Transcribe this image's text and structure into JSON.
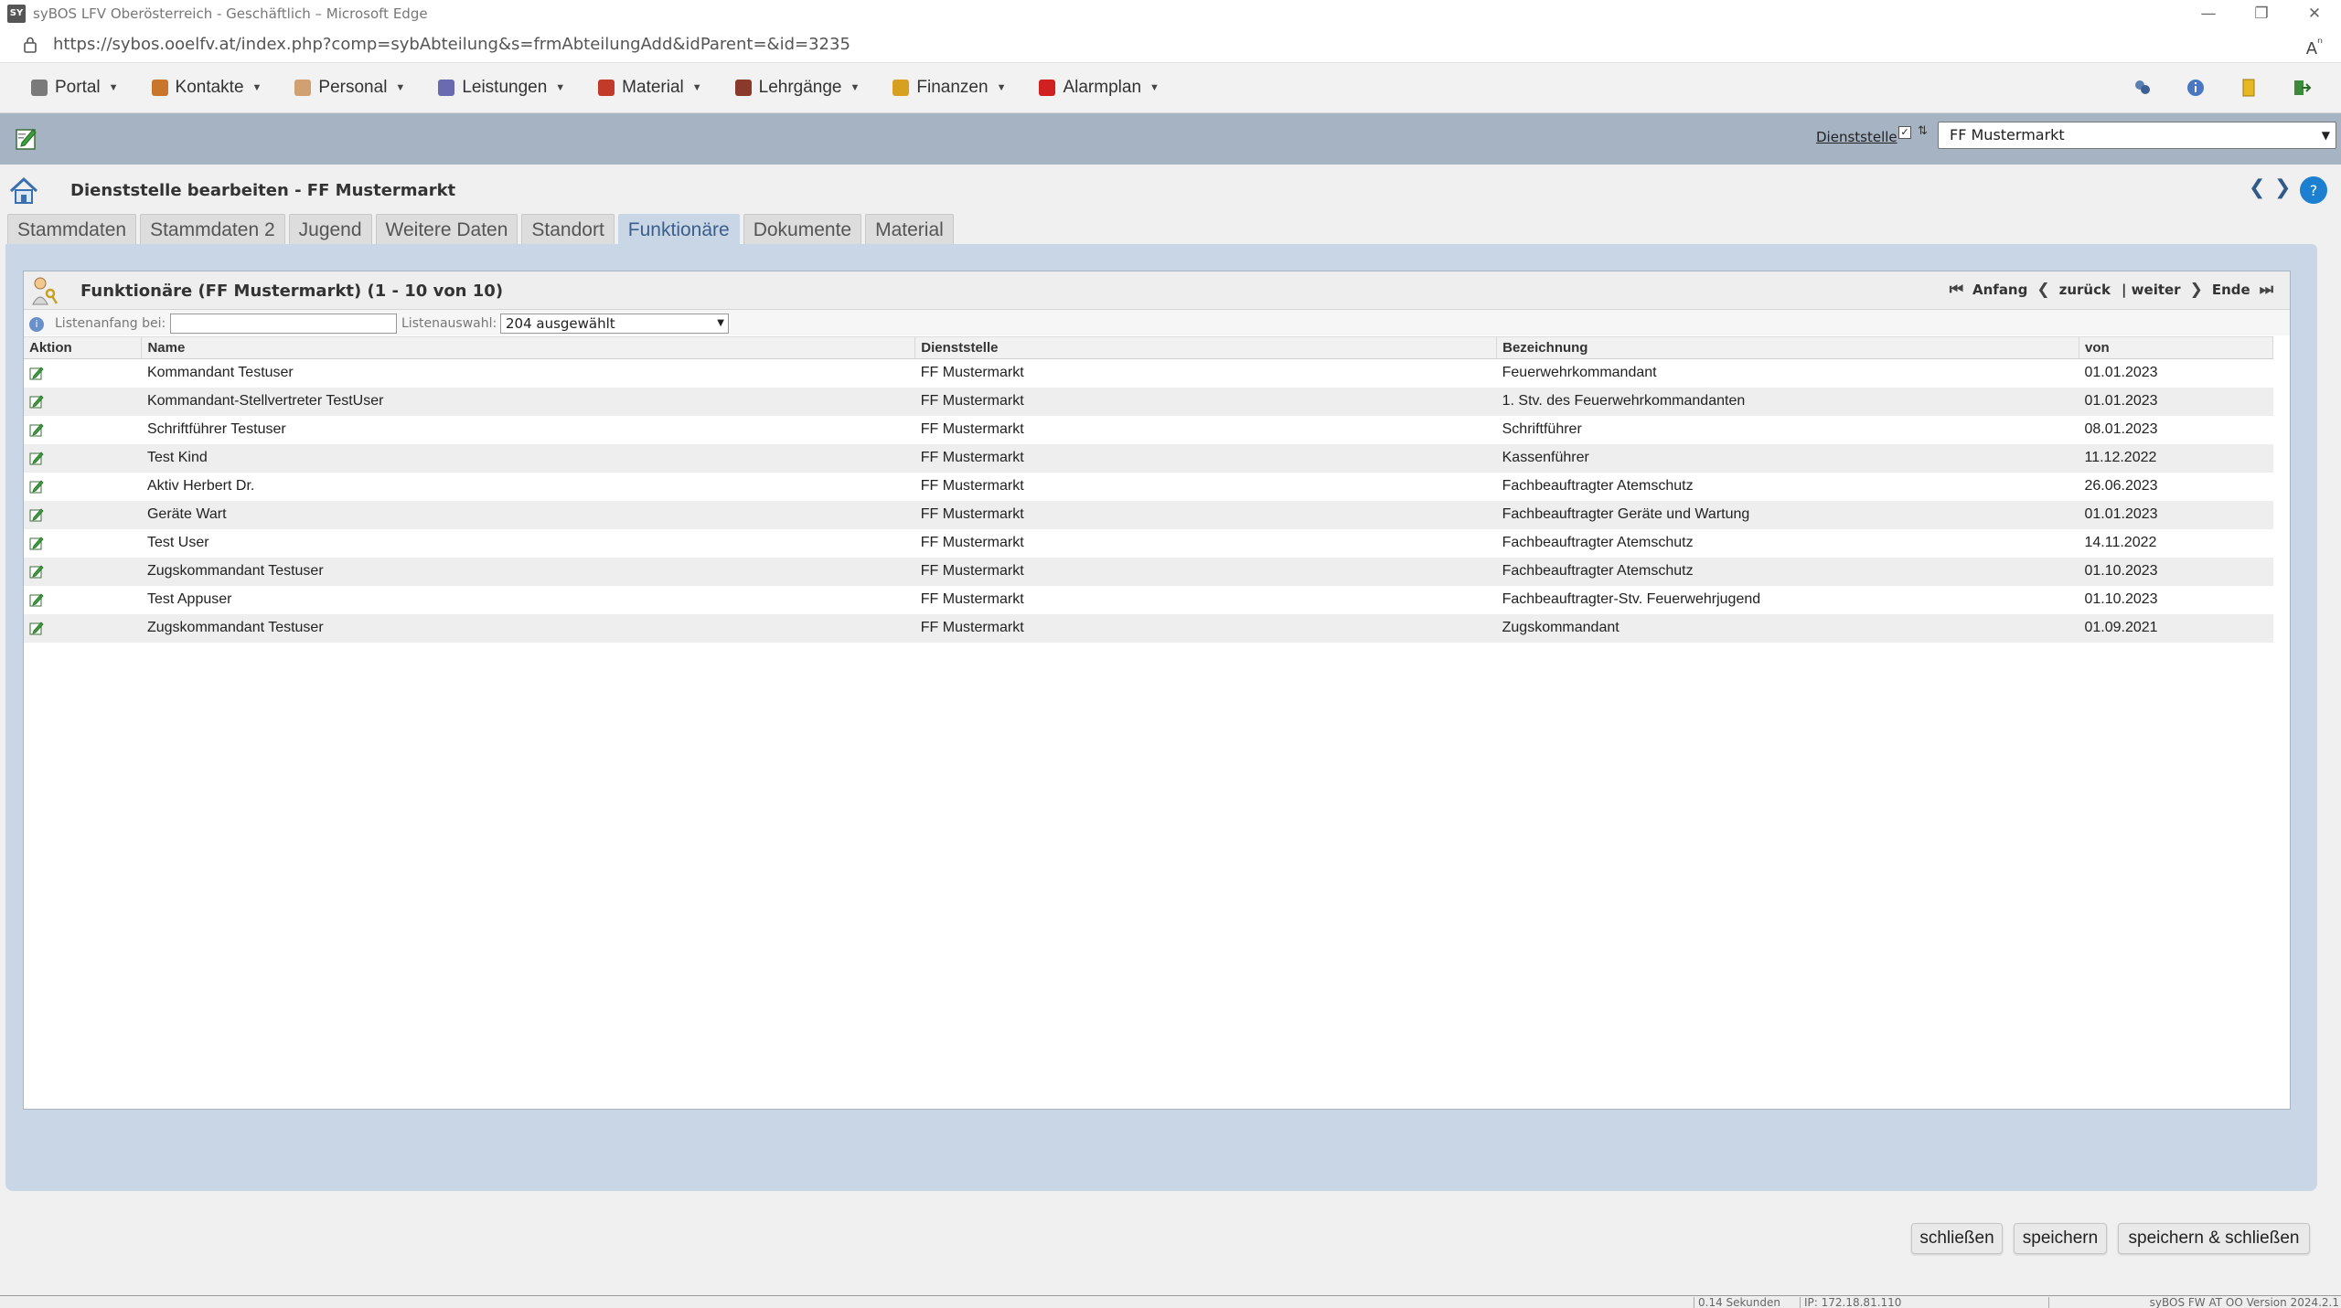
{
  "browser": {
    "window_title": "syBOS LFV Oberösterreich - Geschäftlich – Microsoft Edge",
    "url": "https://sybos.ooelfv.at/index.php?comp=sybAbteilung&s=frmAbteilungAdd&idParent=&id=3235",
    "favicon_text": "SY"
  },
  "menu": {
    "items": [
      {
        "label": "Portal",
        "icon": "portal-icon",
        "color": "#7a7a7a"
      },
      {
        "label": "Kontakte",
        "icon": "contacts-icon",
        "color": "#c8762b"
      },
      {
        "label": "Personal",
        "icon": "person-icon",
        "color": "#d0a070"
      },
      {
        "label": "Leistungen",
        "icon": "services-icon",
        "color": "#6a6ab0"
      },
      {
        "label": "Material",
        "icon": "truck-icon",
        "color": "#c23a2a"
      },
      {
        "label": "Lehrgänge",
        "icon": "course-icon",
        "color": "#8a3a2a"
      },
      {
        "label": "Finanzen",
        "icon": "money-icon",
        "color": "#d8a020"
      },
      {
        "label": "Alarmplan",
        "icon": "alarm-icon",
        "color": "#d02020"
      }
    ]
  },
  "toolbar": {
    "dienststelle_label": "Dienststelle",
    "dienststelle_check": "✓",
    "dienststelle_sort": "⇅",
    "dienststelle_value": "FF Mustermarkt"
  },
  "header": {
    "title": "Dienststelle bearbeiten - FF Mustermarkt",
    "prev": "❮",
    "next": "❯",
    "help": "?"
  },
  "tabs": [
    "Stammdaten",
    "Stammdaten 2",
    "Jugend",
    "Weitere Daten",
    "Standort",
    "Funktionäre",
    "Dokumente",
    "Material"
  ],
  "active_tab": "Funktionäre",
  "list": {
    "title": "Funktionäre (FF Mustermarkt) (1 - 10 von 10)",
    "pager": {
      "first_icon": "⏮",
      "first": "Anfang",
      "prev_icon": "❮",
      "prev": "zurück",
      "next": "| weiter",
      "next_icon": "❯",
      "last": "Ende",
      "last_icon": "⏭"
    },
    "filter": {
      "start_label": "Listenanfang bei:",
      "start_value": "",
      "select_label": "Listenauswahl:",
      "select_value": "204 ausgewählt"
    },
    "columns": [
      "Aktion",
      "Name",
      "Dienststelle",
      "Bezeichnung",
      "von"
    ],
    "rows": [
      {
        "name": "Kommandant Testuser",
        "dienststelle": "FF Mustermarkt",
        "bezeichnung": "Feuerwehrkommandant",
        "von": "01.01.2023"
      },
      {
        "name": "Kommandant-Stellvertreter TestUser",
        "dienststelle": "FF Mustermarkt",
        "bezeichnung": "1. Stv. des Feuerwehrkommandanten",
        "von": "01.01.2023"
      },
      {
        "name": "Schriftführer Testuser",
        "dienststelle": "FF Mustermarkt",
        "bezeichnung": "Schriftführer",
        "von": "08.01.2023"
      },
      {
        "name": "Test Kind",
        "dienststelle": "FF Mustermarkt",
        "bezeichnung": "Kassenführer",
        "von": "11.12.2022"
      },
      {
        "name": "Aktiv Herbert Dr.",
        "dienststelle": "FF Mustermarkt",
        "bezeichnung": "Fachbeauftragter Atemschutz",
        "von": "26.06.2023"
      },
      {
        "name": "Geräte Wart",
        "dienststelle": "FF Mustermarkt",
        "bezeichnung": "Fachbeauftragter Geräte und Wartung",
        "von": "01.01.2023"
      },
      {
        "name": "Test User",
        "dienststelle": "FF Mustermarkt",
        "bezeichnung": "Fachbeauftragter Atemschutz",
        "von": "14.11.2022"
      },
      {
        "name": "Zugskommandant Testuser",
        "dienststelle": "FF Mustermarkt",
        "bezeichnung": "Fachbeauftragter Atemschutz",
        "von": "01.10.2023"
      },
      {
        "name": "Test Appuser",
        "dienststelle": "FF Mustermarkt",
        "bezeichnung": "Fachbeauftragter-Stv. Feuerwehrjugend",
        "von": "01.10.2023"
      },
      {
        "name": "Zugskommandant Testuser",
        "dienststelle": "FF Mustermarkt",
        "bezeichnung": "Zugskommandant",
        "von": "01.09.2021"
      }
    ]
  },
  "buttons": {
    "close": "schließen",
    "save": "speichern",
    "save_close": "speichern & schließen"
  },
  "statusbar": {
    "time": "0.14 Sekunden",
    "ip": "IP: 172.18.81.110",
    "version": "syBOS FW AT OO Version 2024.2.1"
  },
  "colors": {
    "toolbar": "#a6b3c3",
    "panel": "#c9d6e6",
    "active_tab_text": "#3b5f8a"
  }
}
